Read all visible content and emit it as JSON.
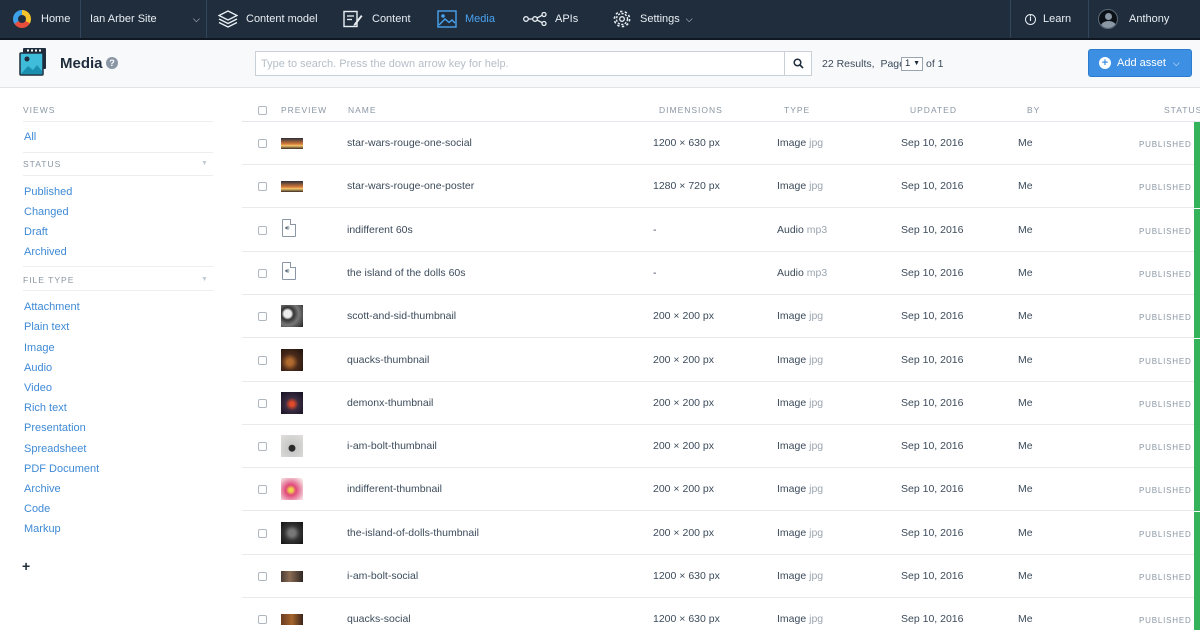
{
  "topnav": {
    "home": "Home",
    "space": "Ian Arber Site",
    "content_model": "Content model",
    "content": "Content",
    "media": "Media",
    "apis": "APIs",
    "settings": "Settings",
    "learn": "Learn",
    "user": "Anthony",
    "active_color": "#4aa3f0",
    "bg_color": "#1f2d3d"
  },
  "header": {
    "title": "Media",
    "search_placeholder": "Type to search. Press the down arrow key for help.",
    "results": "22 Results,",
    "page_label": "Page",
    "page_value": "1",
    "of_total": "of 1",
    "add_asset": "Add asset",
    "accent_color": "#3c8fe3"
  },
  "sidebar": {
    "views_heading": "VIEWS",
    "views": [
      "All"
    ],
    "status_heading": "STATUS",
    "statuses": [
      "Published",
      "Changed",
      "Draft",
      "Archived"
    ],
    "filetype_heading": "FILE TYPE",
    "filetypes": [
      "Attachment",
      "Plain text",
      "Image",
      "Audio",
      "Video",
      "Rich text",
      "Presentation",
      "Spreadsheet",
      "PDF Document",
      "Archive",
      "Code",
      "Markup"
    ],
    "add": "+"
  },
  "table": {
    "columns": [
      "PREVIEW",
      "NAME",
      "DIMENSIONS",
      "TYPE",
      "UPDATED",
      "BY",
      "STATUS"
    ],
    "status_color": "#35b35b",
    "rows": [
      {
        "name": "star-wars-rouge-one-social",
        "dims": "1200 × 630 px",
        "type": "Image",
        "ext": "jpg",
        "updated": "Sep 10, 2016",
        "by": "Me",
        "status": "PUBLISHED",
        "preview": "wide-sunset"
      },
      {
        "name": "star-wars-rouge-one-poster",
        "dims": "1280 × 720 px",
        "type": "Image",
        "ext": "jpg",
        "updated": "Sep 10, 2016",
        "by": "Me",
        "status": "PUBLISHED",
        "preview": "wide-sunset"
      },
      {
        "name": "indifferent 60s",
        "dims": "-",
        "type": "Audio",
        "ext": "mp3",
        "updated": "Sep 10, 2016",
        "by": "Me",
        "status": "PUBLISHED",
        "preview": "audio"
      },
      {
        "name": "the island of the dolls 60s",
        "dims": "-",
        "type": "Audio",
        "ext": "mp3",
        "updated": "Sep 10, 2016",
        "by": "Me",
        "status": "PUBLISHED",
        "preview": "audio"
      },
      {
        "name": "scott-and-sid-thumbnail",
        "dims": "200 × 200 px",
        "type": "Image",
        "ext": "jpg",
        "updated": "Sep 10, 2016",
        "by": "Me",
        "status": "PUBLISHED",
        "preview": "bw"
      },
      {
        "name": "quacks-thumbnail",
        "dims": "200 × 200 px",
        "type": "Image",
        "ext": "jpg",
        "updated": "Sep 10, 2016",
        "by": "Me",
        "status": "PUBLISHED",
        "preview": "dark-brown"
      },
      {
        "name": "demonx-thumbnail",
        "dims": "200 × 200 px",
        "type": "Image",
        "ext": "jpg",
        "updated": "Sep 10, 2016",
        "by": "Me",
        "status": "PUBLISHED",
        "preview": "dark-red"
      },
      {
        "name": "i-am-bolt-thumbnail",
        "dims": "200 × 200 px",
        "type": "Image",
        "ext": "jpg",
        "updated": "Sep 10, 2016",
        "by": "Me",
        "status": "PUBLISHED",
        "preview": "grey-figure"
      },
      {
        "name": "indifferent-thumbnail",
        "dims": "200 × 200 px",
        "type": "Image",
        "ext": "jpg",
        "updated": "Sep 10, 2016",
        "by": "Me",
        "status": "PUBLISHED",
        "preview": "pink"
      },
      {
        "name": "the-island-of-dolls-thumbnail",
        "dims": "200 × 200 px",
        "type": "Image",
        "ext": "jpg",
        "updated": "Sep 10, 2016",
        "by": "Me",
        "status": "PUBLISHED",
        "preview": "dark-grey"
      },
      {
        "name": "i-am-bolt-social",
        "dims": "1200 × 630 px",
        "type": "Image",
        "ext": "jpg",
        "updated": "Sep 10, 2016",
        "by": "Me",
        "status": "PUBLISHED",
        "preview": "wide-dark"
      },
      {
        "name": "quacks-social",
        "dims": "1200 × 630 px",
        "type": "Image",
        "ext": "jpg",
        "updated": "Sep 10, 2016",
        "by": "Me",
        "status": "PUBLISHED",
        "preview": "wide-brown"
      }
    ]
  }
}
